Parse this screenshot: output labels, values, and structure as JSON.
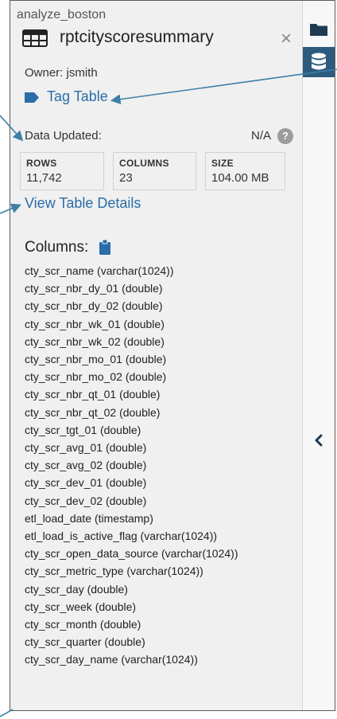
{
  "panel": {
    "schema": "analyze_boston",
    "table_name": "rptcityscoresummary",
    "close_symbol": "×",
    "owner": "Owner: jsmith",
    "tag_label": "Tag Table",
    "updated_label": "Data Updated:",
    "updated_value": "N/A",
    "help_symbol": "?",
    "stats": [
      {
        "header": "ROWS",
        "value": "11,742"
      },
      {
        "header": "COLUMNS",
        "value": "23"
      },
      {
        "header": "SIZE",
        "value": "104.00 MB"
      }
    ],
    "details_link": "View Table Details",
    "columns_heading": "Columns:",
    "columns": [
      "cty_scr_name (varchar(1024))",
      "cty_scr_nbr_dy_01 (double)",
      "cty_scr_nbr_dy_02 (double)",
      "cty_scr_nbr_wk_01 (double)",
      "cty_scr_nbr_wk_02 (double)",
      "cty_scr_nbr_mo_01 (double)",
      "cty_scr_nbr_mo_02 (double)",
      "cty_scr_nbr_qt_01 (double)",
      "cty_scr_nbr_qt_02 (double)",
      "cty_scr_tgt_01 (double)",
      "cty_scr_avg_01 (double)",
      "cty_scr_avg_02 (double)",
      "cty_scr_dev_01 (double)",
      "cty_scr_dev_02 (double)",
      "etl_load_date (timestamp)",
      "etl_load_is_active_flag (varchar(1024))",
      "cty_scr_open_data_source (varchar(1024))",
      "cty_scr_metric_type (varchar(1024))",
      "cty_scr_day (double)",
      "cty_scr_week (double)",
      "cty_scr_month (double)",
      "cty_scr_quarter (double)",
      "cty_scr_day_name (varchar(1024))"
    ]
  },
  "rail": {
    "items": [
      {
        "icon": "folder-icon",
        "active": false
      },
      {
        "icon": "database-icon",
        "active": true
      }
    ],
    "collapse_icon": "chevron-left-icon"
  },
  "colors": {
    "link": "#2a6da8",
    "panel_bg": "#f0f0f0",
    "rail_active": "#2c5b7e",
    "icon_dark": "#1f3a52",
    "annotation": "#3d7fa6"
  }
}
